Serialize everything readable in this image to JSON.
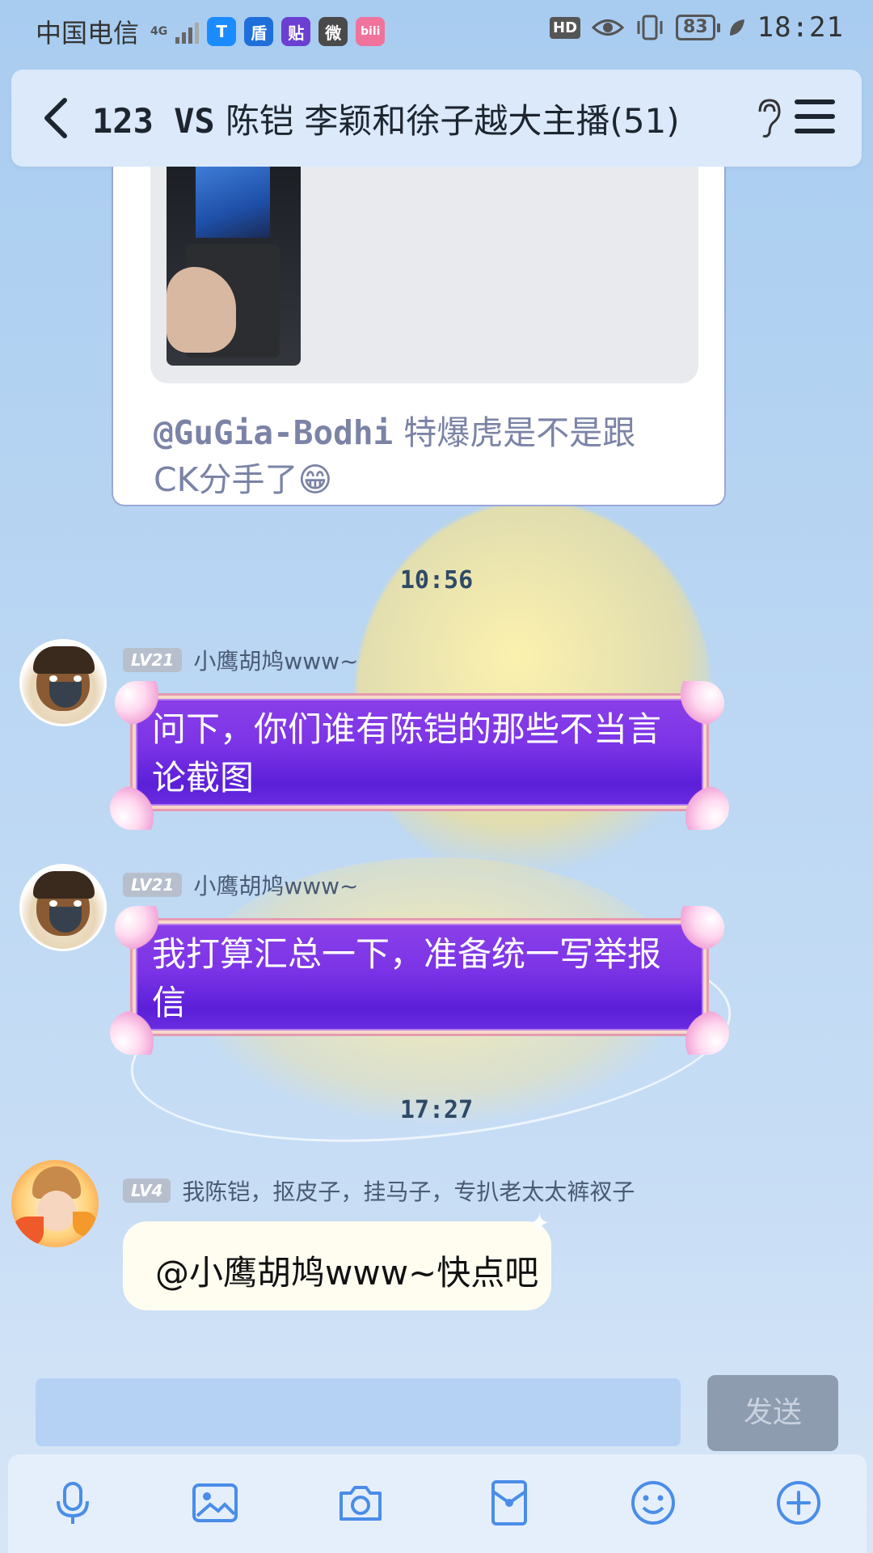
{
  "status_bar": {
    "carrier": "中国电信",
    "network": "4G",
    "apps": [
      "T",
      "盾",
      "贴",
      "微",
      "bili"
    ],
    "hd_label": "HD",
    "battery": "83",
    "time": "18:21"
  },
  "header": {
    "title_left": "123 VS",
    "title_right": "陈铠  李颖和徐子越大主播(51)"
  },
  "quoted_card": {
    "mention": "@GuGia-Bodhi",
    "text_line1": " 特爆虎是不是跟",
    "text_line2": "CK分手了😁"
  },
  "timestamps": [
    "10:56",
    "17:27"
  ],
  "messages": [
    {
      "level": "LV21",
      "nickname": "小鹰胡鸠www~",
      "text": "问下，你们谁有陈铠的那些不当言论截图"
    },
    {
      "level": "LV21",
      "nickname": "小鹰胡鸠www~",
      "text": "我打算汇总一下，准备统一写举报信"
    },
    {
      "level": "LV4",
      "nickname": "我陈铠，抠皮子，挂马子，专扒老太太裤衩子",
      "text": "@小鹰胡鸠www~快点吧"
    }
  ],
  "input": {
    "value": "",
    "placeholder": "",
    "send_label": "发送"
  },
  "toolbar": {
    "icons": [
      "microphone-icon",
      "image-icon",
      "camera-icon",
      "red-packet-icon",
      "emoji-icon",
      "plus-icon"
    ]
  },
  "colors": {
    "bubble_purple": "#7b33e6",
    "header_bg": "#ddeafa",
    "send_button": "#8e9cb0"
  }
}
